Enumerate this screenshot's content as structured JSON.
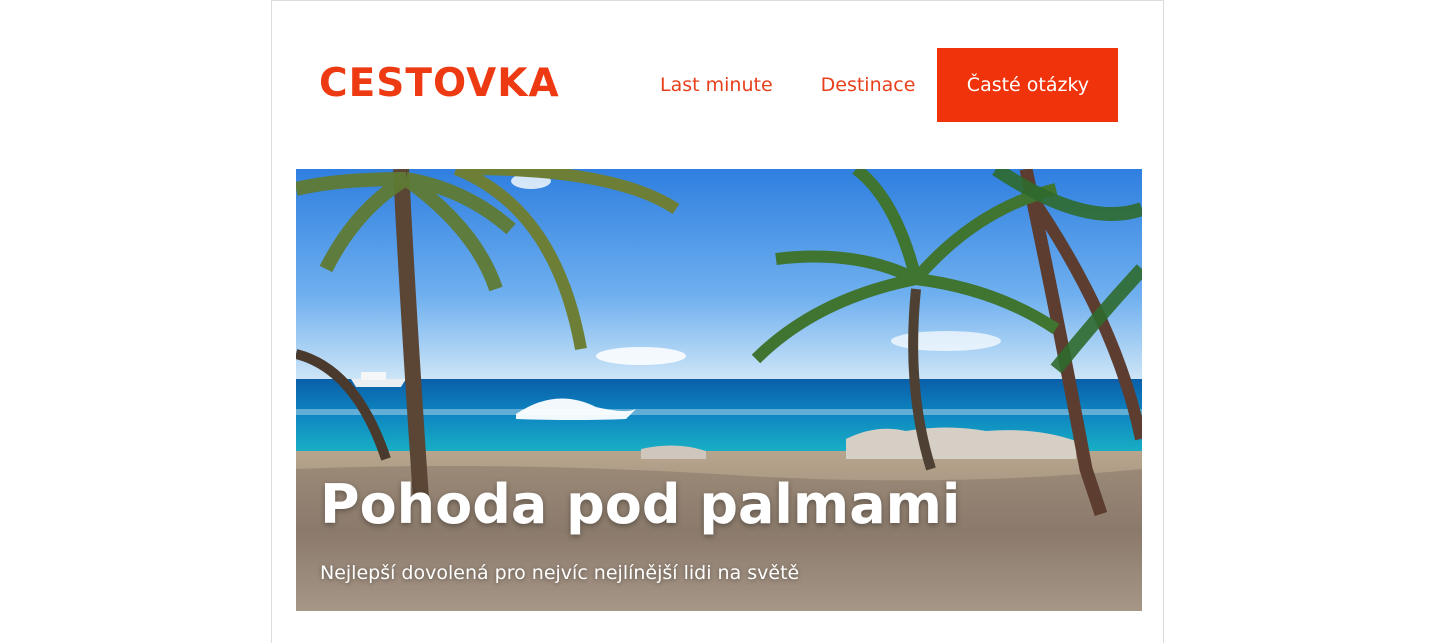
{
  "header": {
    "logo": "CESTOVKA",
    "nav": [
      {
        "label": "Last minute",
        "active": false
      },
      {
        "label": "Destinace",
        "active": false
      },
      {
        "label": "Časté otázky",
        "active": true
      }
    ]
  },
  "hero": {
    "title": "Pohoda pod palmami",
    "subtitle": "Nejlepší dovolená pro nejvíc nejlínější lidi na světě",
    "image": "beach-with-palm-trees-photo"
  },
  "colors": {
    "accent": "#f0330a",
    "logo": "#ee3a12"
  }
}
